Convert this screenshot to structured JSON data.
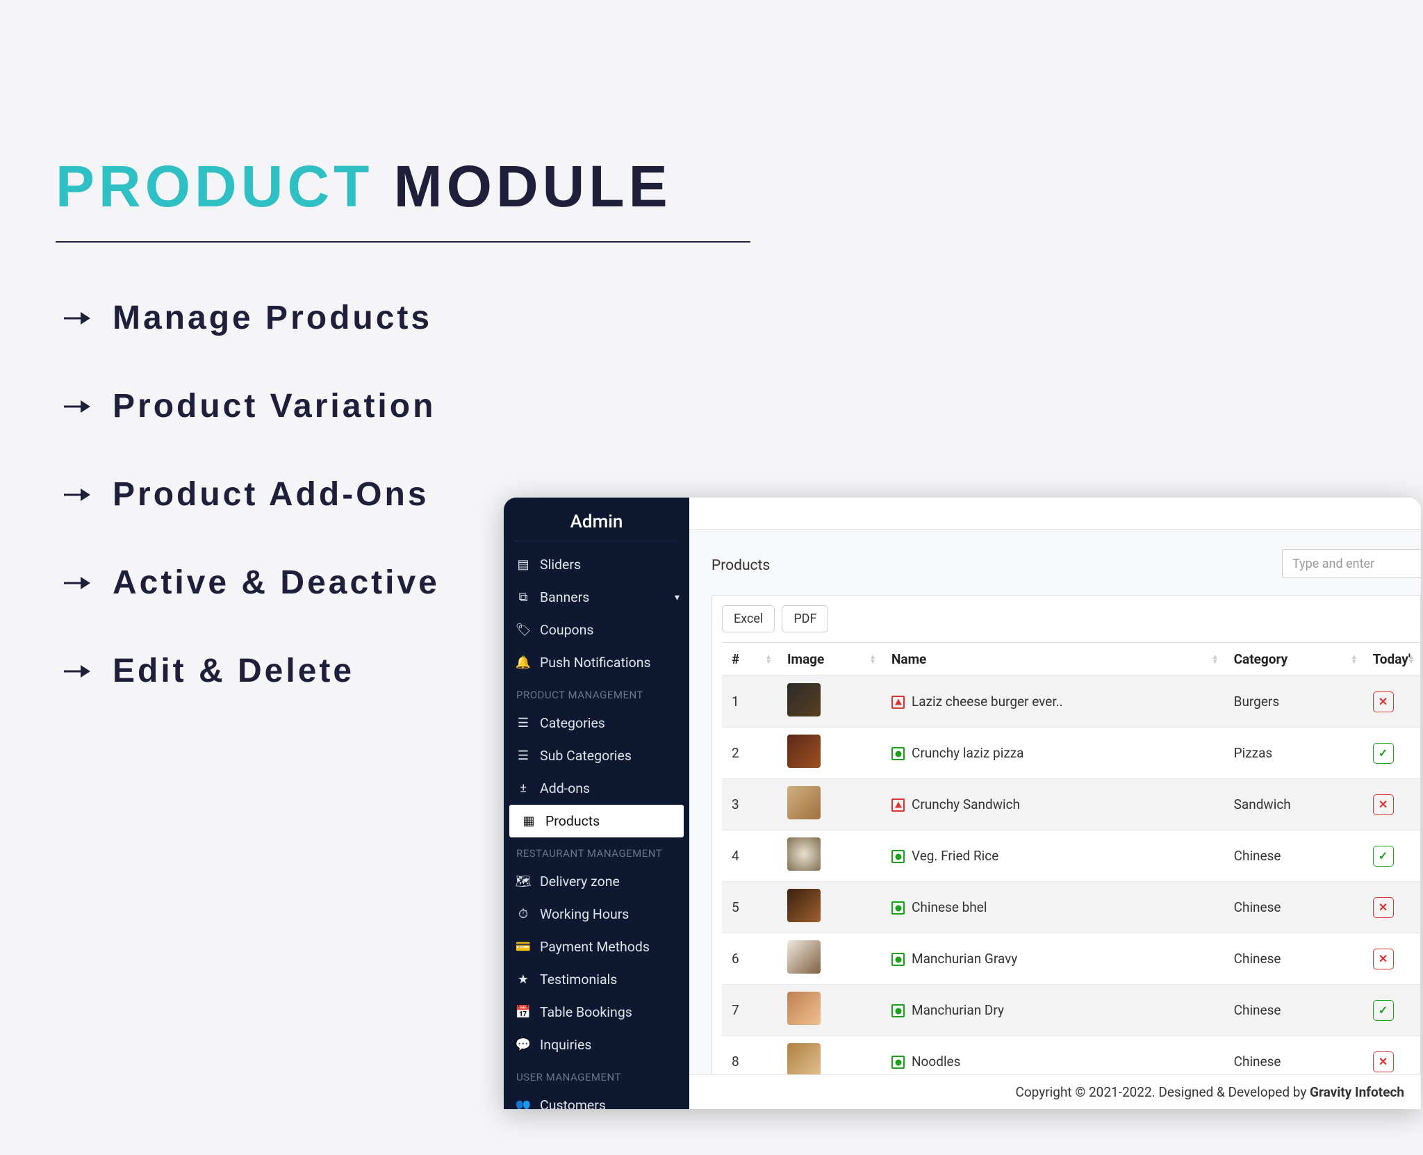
{
  "title": {
    "teal": "PRODUCT",
    "dark": "MODULE"
  },
  "bullets": [
    "Manage Products",
    "Product Variation",
    "Product Add-Ons",
    "Active & Deactive",
    "Edit & Delete"
  ],
  "admin": {
    "brand": "Admin",
    "search_placeholder": "Type and enter",
    "page_title": "Products",
    "btn_excel": "Excel",
    "btn_pdf": "PDF",
    "sections": {
      "top": [
        "Sliders",
        "Banners",
        "Coupons",
        "Push Notifications"
      ],
      "pm_label": "PRODUCT MANAGEMENT",
      "pm": [
        "Categories",
        "Sub Categories",
        "Add-ons",
        "Products"
      ],
      "rm_label": "RESTAURANT MANAGEMENT",
      "rm": [
        "Delivery zone",
        "Working Hours",
        "Payment Methods",
        "Testimonials",
        "Table Bookings",
        "Inquiries"
      ],
      "um_label": "USER MANAGEMENT",
      "um": [
        "Customers"
      ]
    },
    "cols": [
      "#",
      "Image",
      "Name",
      "Category",
      "Today'"
    ],
    "rows": [
      {
        "n": "1",
        "veg": "red",
        "name": "Laziz cheese burger ever..",
        "cat": "Burgers",
        "status": "no",
        "thumb": "t1"
      },
      {
        "n": "2",
        "veg": "green",
        "name": "Crunchy laziz pizza",
        "cat": "Pizzas",
        "status": "ok",
        "thumb": "t2"
      },
      {
        "n": "3",
        "veg": "red",
        "name": "Crunchy Sandwich",
        "cat": "Sandwich",
        "status": "no",
        "thumb": "t3"
      },
      {
        "n": "4",
        "veg": "green",
        "name": "Veg. Fried Rice",
        "cat": "Chinese",
        "status": "ok",
        "thumb": "t4"
      },
      {
        "n": "5",
        "veg": "green",
        "name": "Chinese bhel",
        "cat": "Chinese",
        "status": "no",
        "thumb": "t5"
      },
      {
        "n": "6",
        "veg": "green",
        "name": "Manchurian Gravy",
        "cat": "Chinese",
        "status": "no",
        "thumb": "t6"
      },
      {
        "n": "7",
        "veg": "green",
        "name": "Manchurian Dry",
        "cat": "Chinese",
        "status": "ok",
        "thumb": "t7"
      },
      {
        "n": "8",
        "veg": "green",
        "name": "Noodles",
        "cat": "Chinese",
        "status": "no",
        "thumb": "t8"
      }
    ],
    "footer_pre": "Copyright © 2021-2022. Designed & Developed by ",
    "footer_link": "Gravity Infotech"
  }
}
